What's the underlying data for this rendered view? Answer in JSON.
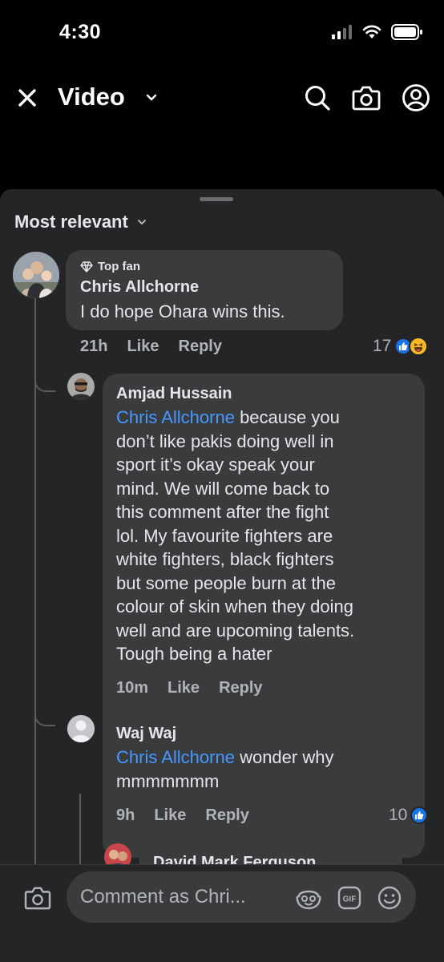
{
  "status": {
    "time": "4:30"
  },
  "header": {
    "title": "Video"
  },
  "sort": {
    "label": "Most relevant"
  },
  "comments": [
    {
      "badge": "Top fan",
      "author": "Chris Allchorne",
      "text": "I do hope Ohara wins this.",
      "time": "21h",
      "like": "Like",
      "reply": "Reply",
      "reactions": "17"
    },
    {
      "author": "Amjad Hussain",
      "mention": "Chris Allchorne",
      "text_lines": [
        " because you",
        "don’t like pakis doing well in",
        "sport it’s okay speak your",
        "mind. We will come back to",
        "this comment after the fight",
        "lol. My favourite fighters are",
        "white fighters, black fighters",
        "but some people burn at the",
        "colour of skin when they doing",
        "well and are upcoming talents.",
        "Tough being a hater"
      ],
      "time": "10m",
      "like": "Like",
      "reply": "Reply"
    },
    {
      "author": "Waj Waj",
      "mention": "Chris Allchorne",
      "text_lines": [
        " wonder why",
        "mmmmmmm"
      ],
      "time": "9h",
      "like": "Like",
      "reply": "Reply",
      "reactions": "10"
    },
    {
      "author": "David Mark Ferguson"
    }
  ],
  "composer": {
    "placeholder": "Comment as Chri..."
  },
  "icons": {
    "close": "close-icon",
    "chevron": "chevron-down-icon",
    "search": "search-icon",
    "camera": "camera-icon",
    "profile": "profile-icon",
    "diamond": "diamond-icon",
    "like": "like-reaction-icon",
    "haha": "haha-reaction-icon",
    "avatar_sticker": "avatar-sticker-icon",
    "gif": "gif-icon",
    "emoji": "emoji-icon"
  },
  "colors": {
    "background": "#000000",
    "sheet": "#242526",
    "bubble": "#3a3b3c",
    "mention": "#4599ff",
    "like": "#1b74e4"
  }
}
